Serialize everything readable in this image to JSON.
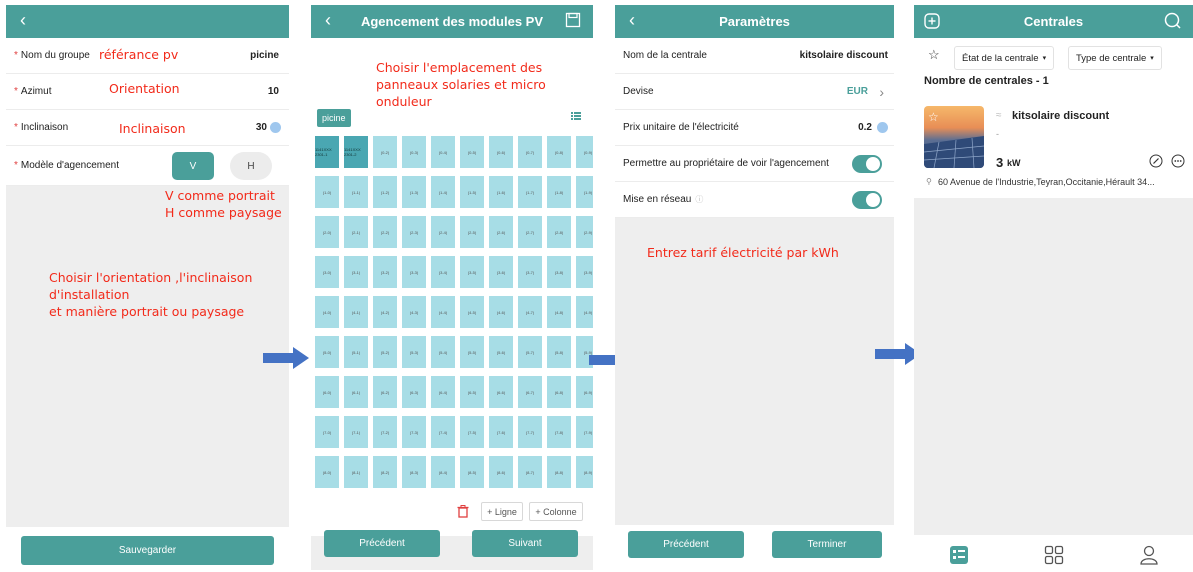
{
  "screen1": {
    "fields": [
      {
        "label": "Nom du groupe",
        "value": "picine"
      },
      {
        "label": "Azimut",
        "value": "10"
      },
      {
        "label": "Inclinaison",
        "value": "30"
      },
      {
        "label": "Modèle d'agencement",
        "value": ""
      }
    ],
    "layout_options": [
      "V",
      "H"
    ],
    "selected_option": "V",
    "save_label": "Sauvegarder",
    "annotations": {
      "ref": "référance pv",
      "orientation": "Orientation",
      "inclinaison": "Inclinaison",
      "vh_line1": "V comme portrait",
      "vh_line2": "H comme paysage",
      "choose_line1": "Choisir l'orientation ,l'inclinaison",
      "choose_line2": "d'installation",
      "choose_line3": "et manière portrait ou paysage"
    }
  },
  "screen2": {
    "title": "Agencement des modules PV",
    "group_chip": "picine",
    "annotation_line1": "Choisir l'emplacement des",
    "annotation_line2": "panneaux solaries et micro",
    "annotation_line3": "onduleur",
    "grid_rows": 9,
    "grid_cols": 10,
    "selected_cells": [
      {
        "row": 0,
        "col": 0,
        "text": "1141XXX 2301-1"
      },
      {
        "row": 0,
        "col": 1,
        "text": "1141XXX 2301-2"
      }
    ],
    "add_row_label": "+ Ligne",
    "add_col_label": "+ Colonne",
    "prev_label": "Précédent",
    "next_label": "Suivant"
  },
  "screen3": {
    "title": "Paramètres",
    "rows": [
      {
        "label": "Nom de la centrale",
        "value": "kitsolaire discount"
      },
      {
        "label": "Devise",
        "value": "EUR"
      },
      {
        "label": "Prix unitaire de l'électricité",
        "value": "0.2"
      },
      {
        "label": "Permettre au propriétaire de voir l'agencement",
        "value": ""
      },
      {
        "label": "Mise en réseau",
        "value": ""
      }
    ],
    "annotation": "Entrez tarif électricité par kWh",
    "prev_label": "Précédent",
    "finish_label": "Terminer"
  },
  "screen4": {
    "title": "Centrales",
    "filter_status": "État de la centrale",
    "filter_type": "Type de centrale",
    "count_label": "Nombre de centrales - 1",
    "card": {
      "name": "kitsolaire discount",
      "dash": "-",
      "power_value": "3",
      "power_unit": "kW",
      "address": "60 Avenue de l'Industrie,Teyran,Occitanie,Hérault 34..."
    }
  },
  "colors": {
    "accent": "#4a9f9a",
    "annotation_red": "#f22a1a",
    "panel_cell": "#a7dde6",
    "arrow_blue": "#4472c4"
  }
}
